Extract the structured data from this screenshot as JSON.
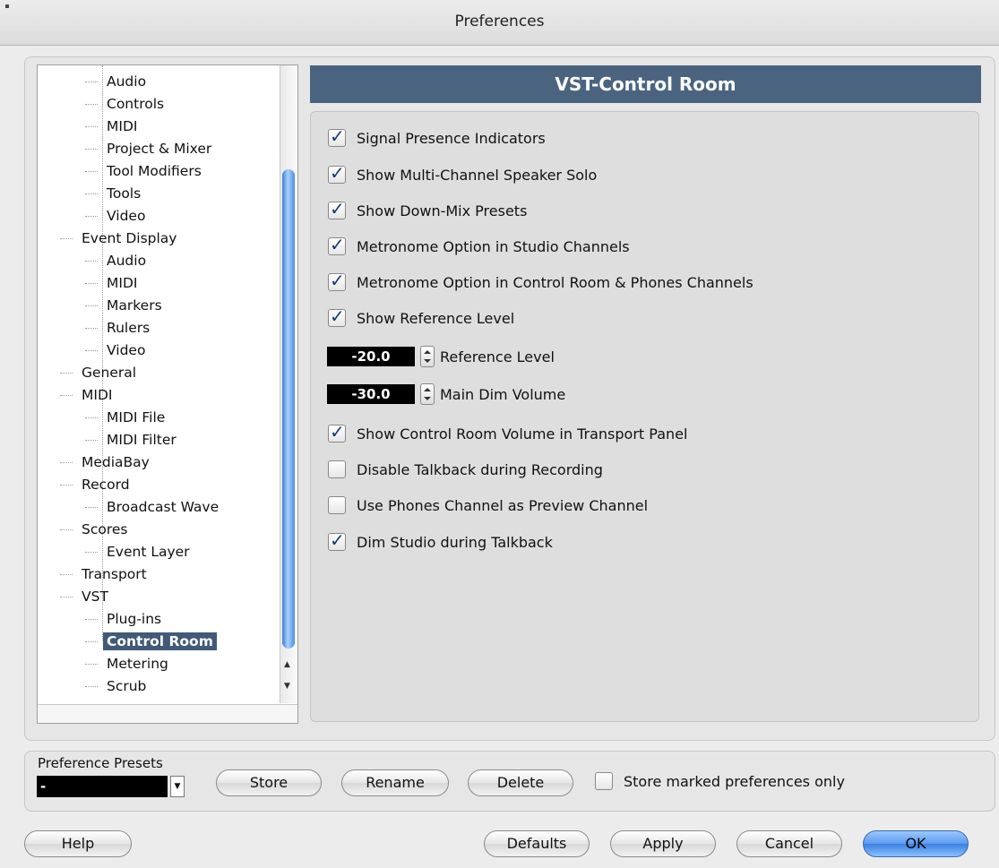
{
  "window": {
    "title": "Preferences"
  },
  "tree": {
    "items": [
      {
        "label": "Audio",
        "level": 2
      },
      {
        "label": "Controls",
        "level": 2
      },
      {
        "label": "MIDI",
        "level": 2
      },
      {
        "label": "Project & Mixer",
        "level": 2
      },
      {
        "label": "Tool Modifiers",
        "level": 2
      },
      {
        "label": "Tools",
        "level": 2
      },
      {
        "label": "Video",
        "level": 2
      },
      {
        "label": "Event Display",
        "level": 1
      },
      {
        "label": "Audio",
        "level": 2
      },
      {
        "label": "MIDI",
        "level": 2
      },
      {
        "label": "Markers",
        "level": 2
      },
      {
        "label": "Rulers",
        "level": 2
      },
      {
        "label": "Video",
        "level": 2
      },
      {
        "label": "General",
        "level": 1
      },
      {
        "label": "MIDI",
        "level": 1
      },
      {
        "label": "MIDI File",
        "level": 2
      },
      {
        "label": "MIDI Filter",
        "level": 2
      },
      {
        "label": "MediaBay",
        "level": 1
      },
      {
        "label": "Record",
        "level": 1
      },
      {
        "label": "Broadcast Wave",
        "level": 2
      },
      {
        "label": "Scores",
        "level": 1
      },
      {
        "label": "Event Layer",
        "level": 2
      },
      {
        "label": "Transport",
        "level": 1
      },
      {
        "label": "VST",
        "level": 1
      },
      {
        "label": "Plug-ins",
        "level": 2
      },
      {
        "label": "Control Room",
        "level": 2,
        "selected": true
      },
      {
        "label": "Metering",
        "level": 2
      },
      {
        "label": "Scrub",
        "level": 2
      }
    ]
  },
  "panel": {
    "title": "VST-Control Room",
    "options": [
      {
        "label": "Signal Presence Indicators",
        "checked": true
      },
      {
        "label": "Show Multi-Channel Speaker Solo",
        "checked": true
      },
      {
        "label": "Show Down-Mix Presets",
        "checked": true
      },
      {
        "label": "Metronome Option in Studio Channels",
        "checked": true
      },
      {
        "label": "Metronome Option in Control Room & Phones Channels",
        "checked": true
      },
      {
        "label": "Show Reference Level",
        "checked": true
      },
      {
        "label": "Show Control Room Volume in Transport Panel",
        "checked": true
      },
      {
        "label": "Disable Talkback during Recording",
        "checked": false
      },
      {
        "label": "Use Phones Channel as Preview Channel",
        "checked": false
      },
      {
        "label": "Dim Studio during Talkback",
        "checked": true
      }
    ],
    "reference_level": {
      "value": "-20.0",
      "label": "Reference Level"
    },
    "main_dim_volume": {
      "value": "-30.0",
      "label": "Main Dim Volume"
    }
  },
  "presets": {
    "title": "Preference Presets",
    "selected": "-",
    "store": "Store",
    "rename": "Rename",
    "delete": "Delete",
    "store_marked_only": {
      "label": "Store marked preferences only",
      "checked": false
    }
  },
  "footer": {
    "help": "Help",
    "defaults": "Defaults",
    "apply": "Apply",
    "cancel": "Cancel",
    "ok": "OK"
  }
}
